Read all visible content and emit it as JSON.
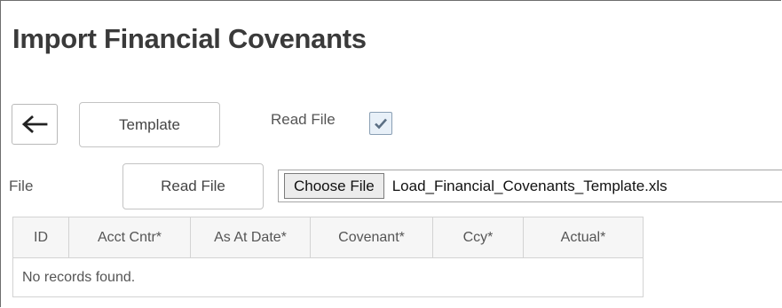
{
  "page": {
    "title": "Import Financial Covenants"
  },
  "toolbar": {
    "back_icon": "arrow-left-icon",
    "template_label": "Template",
    "read_file_label": "Read File",
    "read_file_checked": true
  },
  "file_row": {
    "label": "File",
    "read_file_button": "Read File",
    "choose_file_button": "Choose File",
    "file_name": "Load_Financial_Covenants_Template.xls"
  },
  "table": {
    "columns": [
      "ID",
      "Acct Cntr*",
      "As At Date*",
      "Covenant*",
      "Ccy*",
      "Actual*"
    ],
    "empty_message": "No records found."
  },
  "colors": {
    "border": "#d3d3d3",
    "header_bg": "#f6f6f6",
    "checkbox_bg": "#e8f0f8"
  }
}
